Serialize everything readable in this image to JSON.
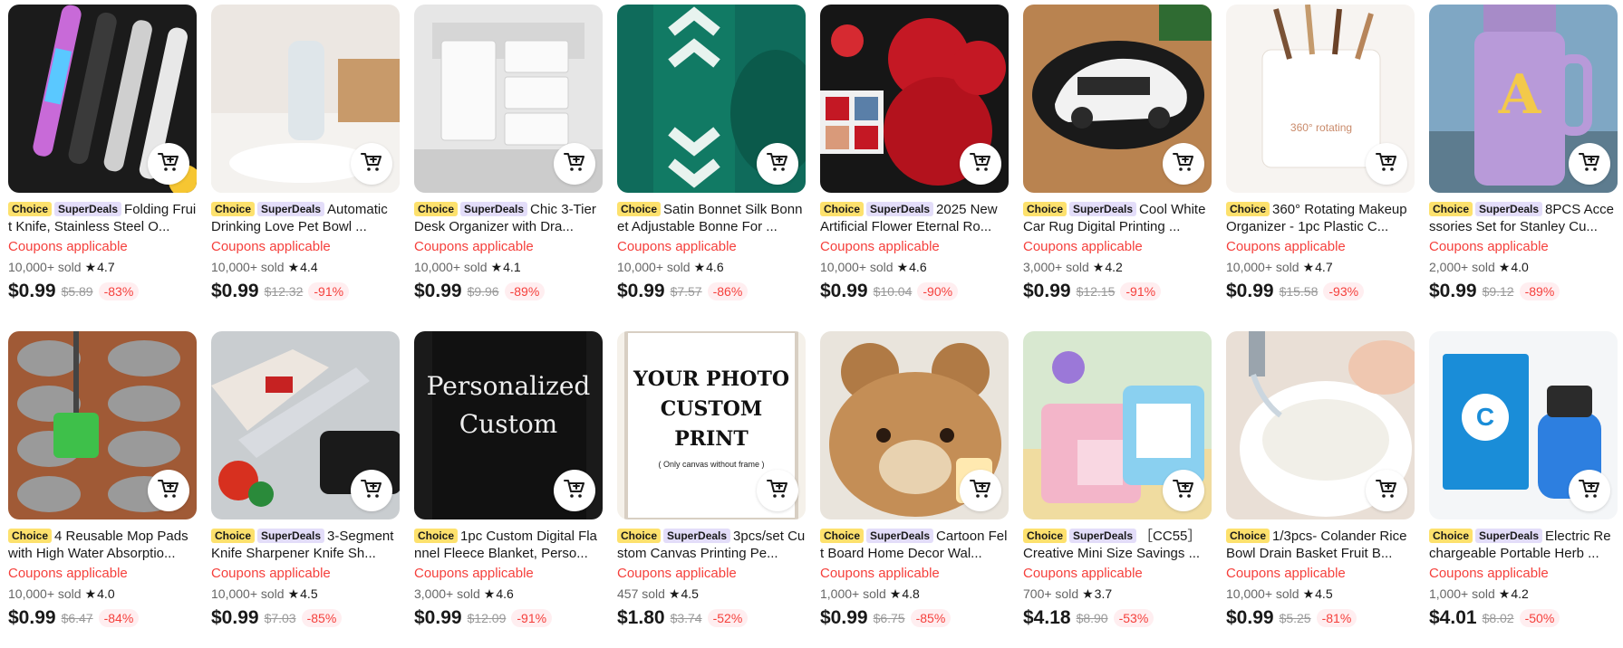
{
  "colors": {
    "accent_red": "#f5403c",
    "choice_badge_bg": "#fde16d",
    "superdeals_badge_bg": "#e3ddf9",
    "discount_pill_bg": "#ffeef0"
  },
  "products": [
    {
      "badges": [
        "Choice",
        "SuperDeals"
      ],
      "title": "Folding Fruit Knife, Stainless Steel O...",
      "coupon": "Coupons applicable",
      "sold": "10,000+ sold",
      "rating": "4.7",
      "price": "$0.99",
      "original_price": "$5.89",
      "discount": "-83%",
      "icon": "folding-knife-image",
      "cart_icon": "add-to-cart-icon"
    },
    {
      "badges": [
        "Choice",
        "SuperDeals"
      ],
      "title": "Automatic Drinking Love Pet Bowl ...",
      "coupon": "Coupons applicable",
      "sold": "10,000+ sold",
      "rating": "4.4",
      "price": "$0.99",
      "original_price": "$12.32",
      "discount": "-91%",
      "icon": "pet-bowl-image",
      "cart_icon": "add-to-cart-icon"
    },
    {
      "badges": [
        "Choice",
        "SuperDeals"
      ],
      "title": "Chic 3-Tier Desk Organizer with Dra...",
      "coupon": "Coupons applicable",
      "sold": "10,000+ sold",
      "rating": "4.1",
      "price": "$0.99",
      "original_price": "$9.96",
      "discount": "-89%",
      "icon": "desk-organizer-image",
      "cart_icon": "add-to-cart-icon"
    },
    {
      "badges": [
        "Choice"
      ],
      "title": "Satin Bonnet Silk Bonnet Adjustable Bonne For ...",
      "coupon": "Coupons applicable",
      "sold": "10,000+ sold",
      "rating": "4.6",
      "price": "$0.99",
      "original_price": "$7.57",
      "discount": "-86%",
      "icon": "satin-bonnet-image",
      "cart_icon": "add-to-cart-icon"
    },
    {
      "badges": [
        "Choice",
        "SuperDeals"
      ],
      "title": "2025 New Artificial Flower Eternal Ro...",
      "coupon": "Coupons applicable",
      "sold": "10,000+ sold",
      "rating": "4.6",
      "price": "$0.99",
      "original_price": "$10.04",
      "discount": "-90%",
      "icon": "rose-bear-image",
      "cart_icon": "add-to-cart-icon"
    },
    {
      "badges": [
        "Choice",
        "SuperDeals"
      ],
      "title": "Cool White Car Rug Digital Printing ...",
      "coupon": "Coupons applicable",
      "sold": "3,000+ sold",
      "rating": "4.2",
      "price": "$0.99",
      "original_price": "$12.15",
      "discount": "-91%",
      "icon": "car-rug-image",
      "cart_icon": "add-to-cart-icon"
    },
    {
      "badges": [
        "Choice"
      ],
      "title": "360° Rotating Makeup Organizer - 1pc Plastic C...",
      "coupon": "Coupons applicable",
      "sold": "10,000+ sold",
      "rating": "4.7",
      "price": "$0.99",
      "original_price": "$15.58",
      "discount": "-93%",
      "icon": "makeup-organizer-image",
      "cart_icon": "add-to-cart-icon"
    },
    {
      "badges": [
        "Choice",
        "SuperDeals"
      ],
      "title": "8PCS Accessories Set for Stanley Cu...",
      "coupon": "Coupons applicable",
      "sold": "2,000+ sold",
      "rating": "4.0",
      "price": "$0.99",
      "original_price": "$9.12",
      "discount": "-89%",
      "icon": "tumbler-image",
      "cart_icon": "add-to-cart-icon"
    },
    {
      "badges": [
        "Choice"
      ],
      "title": "4 Reusable Mop Pads with High Water Absorptio...",
      "coupon": "Coupons applicable",
      "sold": "10,000+ sold",
      "rating": "4.0",
      "price": "$0.99",
      "original_price": "$6.47",
      "discount": "-84%",
      "icon": "mop-pads-image",
      "cart_icon": "add-to-cart-icon"
    },
    {
      "badges": [
        "Choice",
        "SuperDeals"
      ],
      "title": "3-Segment Knife Sharpener Knife Sh...",
      "coupon": "Coupons applicable",
      "sold": "10,000+ sold",
      "rating": "4.5",
      "price": "$0.99",
      "original_price": "$7.03",
      "discount": "-85%",
      "icon": "knife-sharpener-image",
      "cart_icon": "add-to-cart-icon"
    },
    {
      "badges": [
        "Choice"
      ],
      "title": "1pc Custom Digital Flannel Fleece Blanket, Perso...",
      "coupon": "Coupons applicable",
      "sold": "3,000+ sold",
      "rating": "4.6",
      "price": "$0.99",
      "original_price": "$12.09",
      "discount": "-91%",
      "icon": "custom-blanket-image",
      "cart_icon": "add-to-cart-icon",
      "image_text": [
        "Personalized",
        "Custom"
      ]
    },
    {
      "badges": [
        "Choice",
        "SuperDeals"
      ],
      "title": "3pcs/set Custom Canvas Printing Pe...",
      "coupon": "Coupons applicable",
      "sold": "457 sold",
      "rating": "4.5",
      "price": "$1.80",
      "original_price": "$3.74",
      "discount": "-52%",
      "icon": "canvas-print-image",
      "cart_icon": "add-to-cart-icon",
      "image_text": [
        "YOUR PHOTO",
        "CUSTOM",
        "PRINT",
        "( Only canvas without frame )"
      ]
    },
    {
      "badges": [
        "Choice",
        "SuperDeals"
      ],
      "title": "Cartoon Felt Board Home Decor Wal...",
      "coupon": "Coupons applicable",
      "sold": "1,000+ sold",
      "rating": "4.8",
      "price": "$0.99",
      "original_price": "$6.75",
      "discount": "-85%",
      "icon": "felt-board-image",
      "cart_icon": "add-to-cart-icon"
    },
    {
      "badges": [
        "Choice",
        "SuperDeals"
      ],
      "title": "［CC55］ Creative Mini Size Savings ...",
      "coupon": "Coupons applicable",
      "sold": "700+ sold",
      "rating": "3.7",
      "price": "$4.18",
      "original_price": "$8.90",
      "discount": "-53%",
      "icon": "savings-box-image",
      "cart_icon": "add-to-cart-icon"
    },
    {
      "badges": [
        "Choice"
      ],
      "title": "1/3pcs- Colander Rice Bowl Drain Basket Fruit B...",
      "coupon": "Coupons applicable",
      "sold": "10,000+ sold",
      "rating": "4.5",
      "price": "$0.99",
      "original_price": "$5.25",
      "discount": "-81%",
      "icon": "colander-image",
      "cart_icon": "add-to-cart-icon"
    },
    {
      "badges": [
        "Choice",
        "SuperDeals"
      ],
      "title": "Electric Rechargeable Portable Herb ...",
      "coupon": "Coupons applicable",
      "sold": "1,000+ sold",
      "rating": "4.2",
      "price": "$4.01",
      "original_price": "$8.02",
      "discount": "-50%",
      "icon": "herb-grinder-image",
      "cart_icon": "add-to-cart-icon"
    }
  ]
}
